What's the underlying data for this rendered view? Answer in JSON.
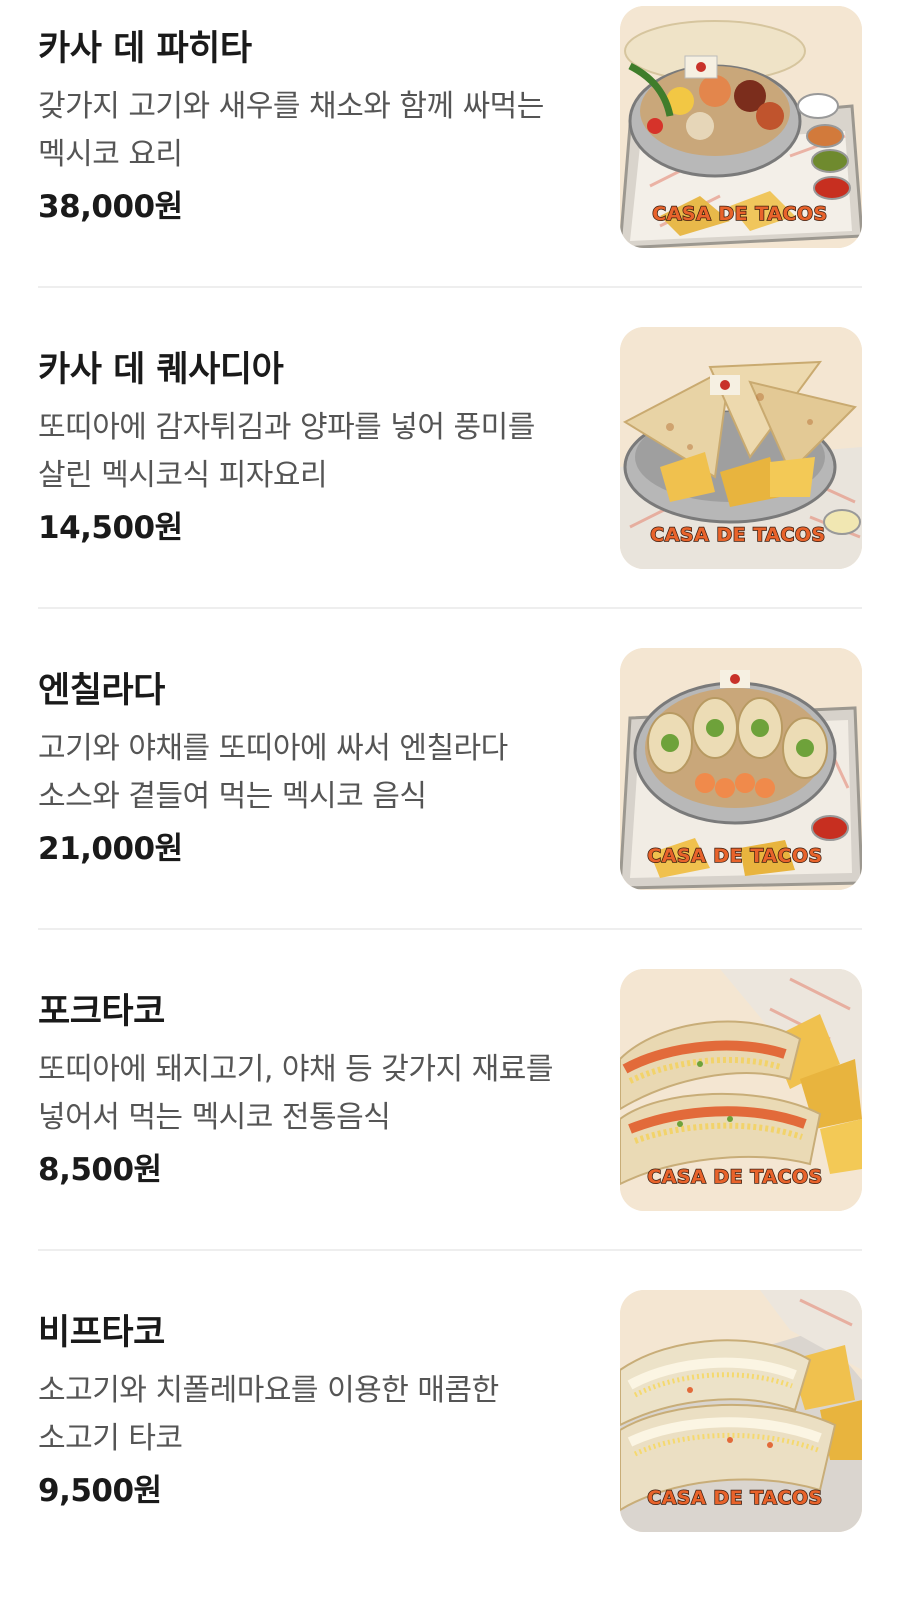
{
  "menu": {
    "items": [
      {
        "name": "카사 데 파히타",
        "description": "갖가지 고기와 새우를 채소와 함께 싸먹는 멕시코 요리",
        "price": "38,000원",
        "image_icon": "fajita-platter-photo",
        "brand": "CASA DE TACOS"
      },
      {
        "name": "카사 데 퀘사디아",
        "description": "또띠아에 감자튀김과 양파를 넣어 풍미를 살린 멕시코식 피자요리",
        "price": "14,500원",
        "image_icon": "quesadilla-photo",
        "brand": "CASA DE TACOS"
      },
      {
        "name": "엔칠라다",
        "description": "고기와 야채를 또띠아에 싸서 엔칠라다 소스와 곁들여 먹는 멕시코 음식",
        "price": "21,000원",
        "image_icon": "enchilada-photo",
        "brand": "CASA DE TACOS"
      },
      {
        "name": "포크타코",
        "description": "또띠아에 돼지고기, 야채 등 갖가지 재료를 넣어서 먹는 멕시코 전통음식",
        "price": "8,500원",
        "image_icon": "pork-taco-photo",
        "brand": "CASA DE TACOS"
      },
      {
        "name": "비프타코",
        "description": "소고기와 치폴레마요를 이용한 매콤한 소고기 타코",
        "price": "9,500원",
        "image_icon": "beef-taco-photo",
        "brand": "CASA DE TACOS"
      }
    ]
  },
  "colors": {
    "thumb_background": "#f4e6d2",
    "brand_text": "#e8632b",
    "brand_outline": "#3a1d10",
    "divider": "#eeeeee"
  }
}
